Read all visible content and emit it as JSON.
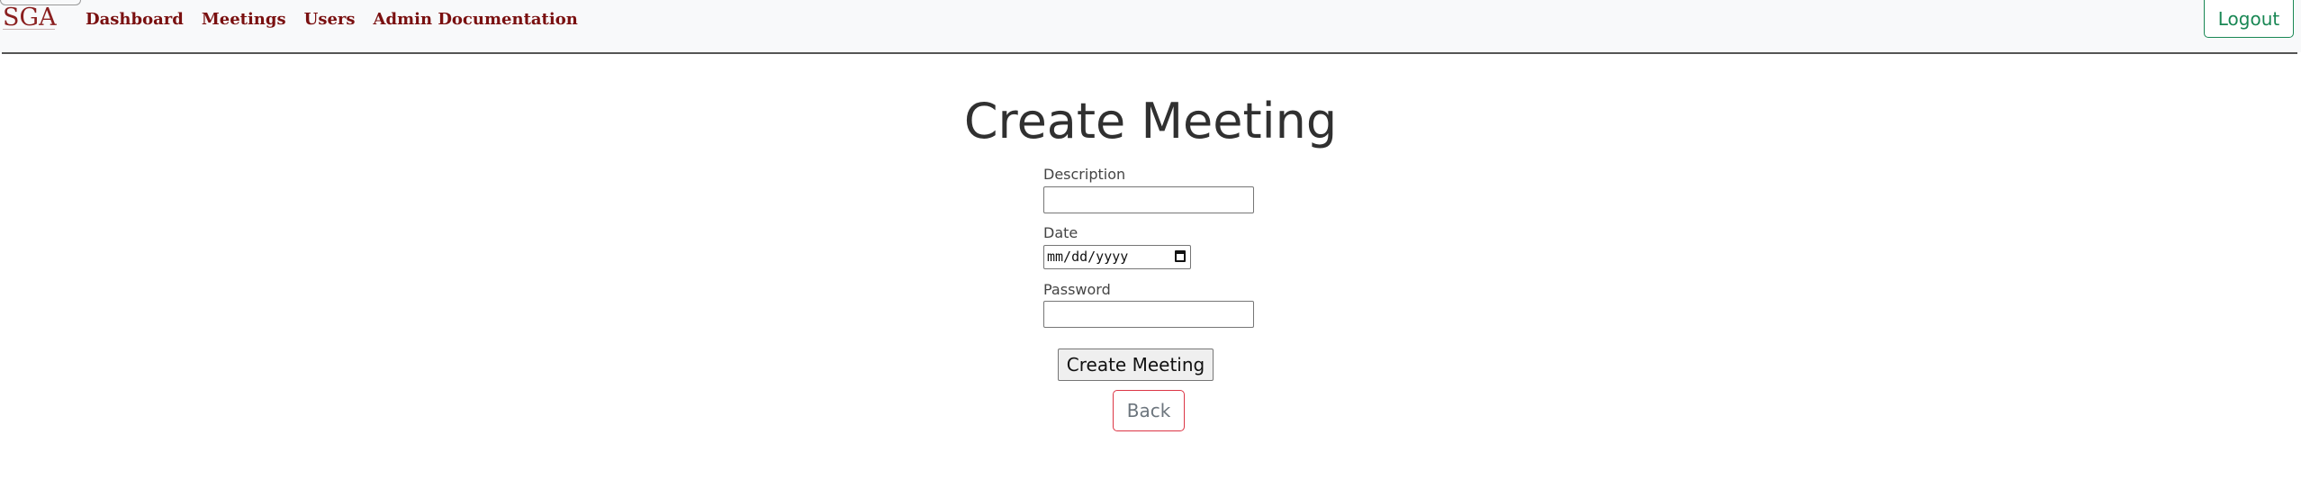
{
  "navbar": {
    "brand": "SGA",
    "links": [
      "Dashboard",
      "Meetings",
      "Users",
      "Admin Documentation"
    ],
    "logout_label": "Logout"
  },
  "main": {
    "title": "Create Meeting",
    "description_label": "Description",
    "description_value": "",
    "date_label": "Date",
    "date_placeholder": "mm/dd/yyyy",
    "password_label": "Password",
    "password_value": "",
    "submit_label": "Create Meeting",
    "back_label": "Back"
  },
  "colors": {
    "nav_link": "#7a1010",
    "logout": "#198754",
    "back_border": "#dc3545"
  }
}
